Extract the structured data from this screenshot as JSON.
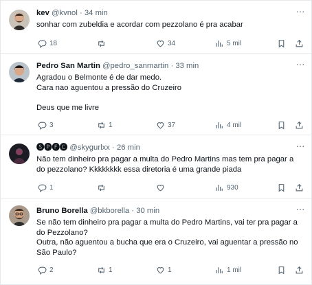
{
  "tweets": [
    {
      "name": "kev",
      "handle": "@kvnol",
      "dot": "·",
      "time": "34 min",
      "text": "sonhar com zubeldia e acordar com pezzolano é pra acabar",
      "replies": "18",
      "retweets": "",
      "likes": "34",
      "views": "5 mil",
      "avatar_icon": "avatar-bearded-man",
      "avatar_color": "#5a4a3c"
    },
    {
      "name": "Pedro San Martin",
      "handle": "@pedro_sanmartin",
      "dot": "·",
      "time": "33 min",
      "text": "Agradou o Belmonte é de dar medo.\nCara nao aguentou a pressão do Cruzeiro\n\nDeus que me livre",
      "replies": "3",
      "retweets": "1",
      "likes": "37",
      "views": "4 mil",
      "avatar_icon": "avatar-dark-hair-man",
      "avatar_color": "#3b2a22"
    },
    {
      "name": "🅢🅟🅕🅒",
      "handle": "@skygurlxx",
      "dot": "·",
      "time": "26 min",
      "text": "Não tem dinheiro pra pagar a multa do Pedro Martins mas tem pra pagar a\ndo pezzolano? Kkkkkkkk essa diretoria é uma grande piada",
      "replies": "1",
      "retweets": "",
      "likes": "",
      "views": "930",
      "avatar_icon": "avatar-dark-figure",
      "avatar_color": "#1d1b24"
    },
    {
      "name": "Bruno Borella",
      "handle": "@bkborella",
      "dot": "·",
      "time": "30 min",
      "text": "Se não tem dinheiro pra pagar a multa do Pedro Martins, vai ter pra pagar a\ndo Pezzolano?\nOutra, não aguentou a bucha que era o Cruzeiro, vai aguentar a pressão no\nSão Paulo?",
      "replies": "2",
      "retweets": "1",
      "likes": "1",
      "views": "1 mil",
      "avatar_icon": "avatar-bearded-glasses",
      "avatar_color": "#6b5546"
    }
  ],
  "icons": {
    "reply": "reply-icon",
    "retweet": "retweet-icon",
    "like": "heart-icon",
    "views": "views-chart-icon",
    "bookmark": "bookmark-icon",
    "share": "share-icon",
    "more": "more-options-icon"
  },
  "menu_glyph": "···",
  "colors": {
    "text": "#0f1419",
    "muted": "#536471",
    "divider": "#e6e9ec"
  }
}
